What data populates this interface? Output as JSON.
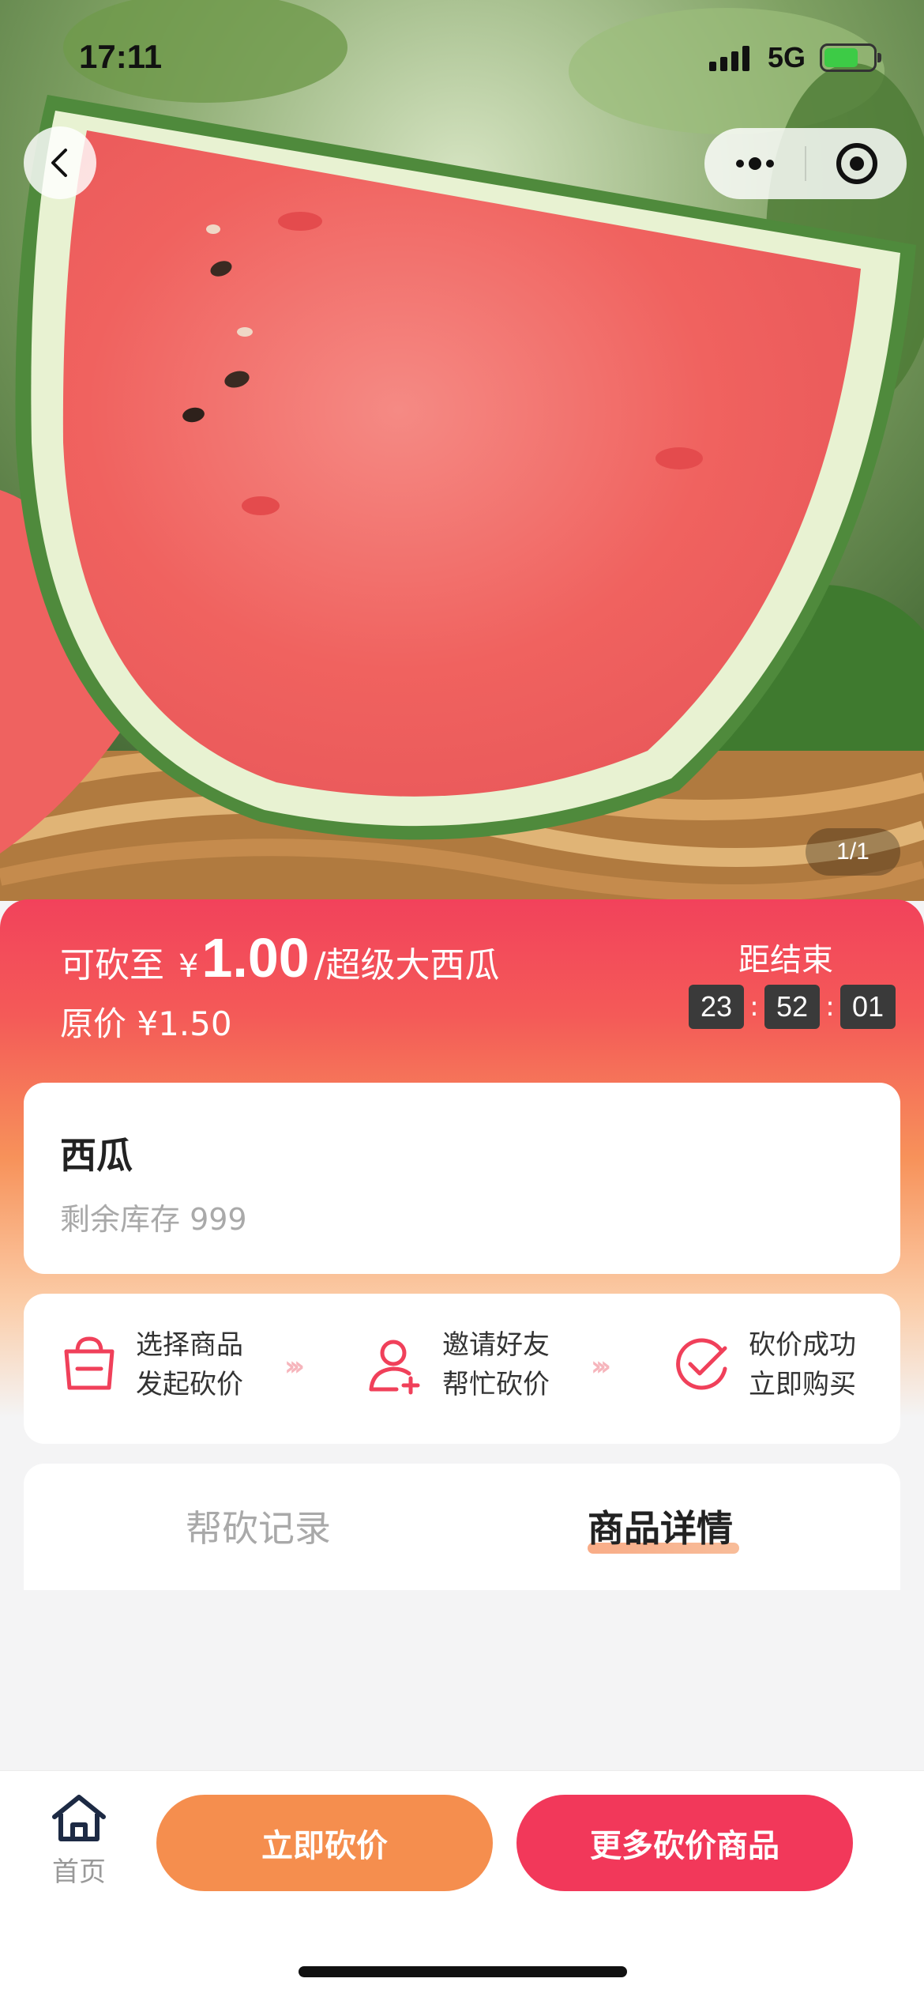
{
  "status_bar": {
    "time": "17:11",
    "network": "5G"
  },
  "hero": {
    "page_indicator": "1/1"
  },
  "price": {
    "prefix": "可砍至",
    "currency": "¥",
    "value": "1.00",
    "suffix": "/超级大西瓜",
    "original": "原价 ¥1.50"
  },
  "countdown": {
    "label": "距结束",
    "hours": "23",
    "minutes": "52",
    "seconds": "01"
  },
  "product": {
    "name": "西瓜",
    "stock": "剩余库存 999"
  },
  "steps": [
    {
      "line1": "选择商品",
      "line2": "发起砍价"
    },
    {
      "line1": "邀请好友",
      "line2": "帮忙砍价"
    },
    {
      "line1": "砍价成功",
      "line2": "立即购买"
    }
  ],
  "tabs": [
    {
      "label": "帮砍记录"
    },
    {
      "label": "商品详情"
    }
  ],
  "bottom": {
    "home_label": "首页",
    "bargain_button": "立即砍价",
    "more_button": "更多砍价商品"
  },
  "colors": {
    "accent_red": "#f2385a",
    "accent_orange": "#f58e4e",
    "battery_green": "#3dcb46"
  }
}
